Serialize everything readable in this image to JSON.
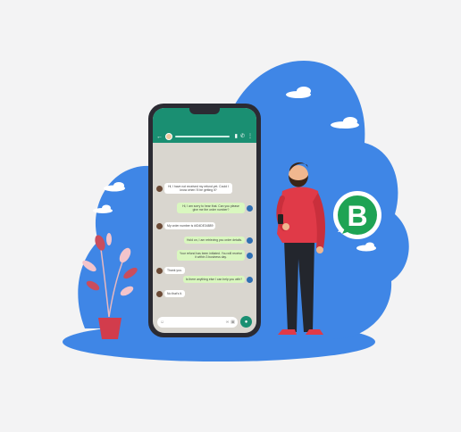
{
  "colors": {
    "background": "#f3f3f4",
    "cloud_blue": "#3f86e6",
    "phone_body": "#2b2b33",
    "chat_header": "#1a8f72",
    "incoming_bubble": "#ffffff",
    "outgoing_bubble": "#d9f7bf",
    "shirt": "#e03a48",
    "badge_green": "#1ea354"
  },
  "badge": {
    "letter": "B",
    "icon": "whatsapp-business-logo"
  },
  "chat": {
    "header_icons": [
      "back-arrow-icon",
      "video-icon",
      "phone-icon",
      "more-icon"
    ],
    "messages": [
      {
        "side": "in",
        "text": "Hi, I have not received my refund yet. Could I know when I'll be getting it?"
      },
      {
        "side": "out",
        "text": "Hi, I am sorry to hear that. Can you please give me the order number?"
      },
      {
        "side": "in",
        "text": "My order number is #ID4DE34889"
      },
      {
        "side": "out",
        "text": "Hold on, I am retrieving you order details."
      },
      {
        "side": "out",
        "text": "Your refund has been initiated. You will receive it within 3 business day."
      },
      {
        "side": "in",
        "text": "Thank you."
      },
      {
        "side": "out",
        "text": "Is there anything else I can help you with?"
      },
      {
        "side": "in",
        "text": "No that's it."
      }
    ],
    "input_icons": [
      "emoji-icon",
      "attach-icon",
      "camera-icon",
      "mic-icon"
    ]
  }
}
